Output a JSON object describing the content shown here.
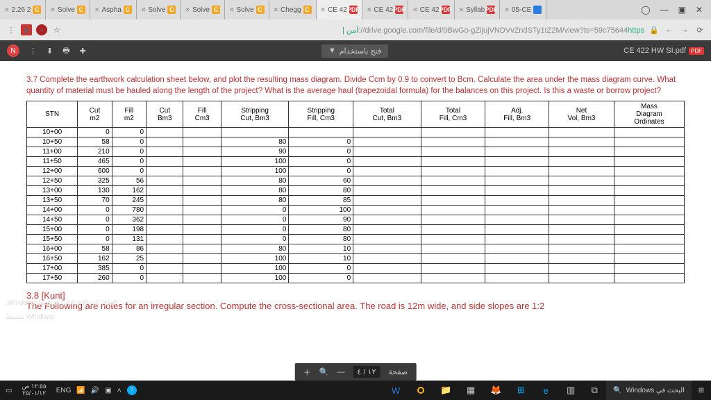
{
  "tabs": [
    {
      "label": "2.26 2",
      "ico": "C",
      "cls": "ico-c"
    },
    {
      "label": "Solve",
      "ico": "C",
      "cls": "ico-c"
    },
    {
      "label": "Aspha",
      "ico": "C",
      "cls": "ico-c"
    },
    {
      "label": "Solve",
      "ico": "C",
      "cls": "ico-c"
    },
    {
      "label": "Solve",
      "ico": "C",
      "cls": "ico-c"
    },
    {
      "label": "Solve",
      "ico": "C",
      "cls": "ico-c"
    },
    {
      "label": "Chegg",
      "ico": "C",
      "cls": "ico-c"
    },
    {
      "label": "CE 42",
      "ico": "PDF",
      "cls": "ico-pdf",
      "active": true
    },
    {
      "label": "CE 42",
      "ico": "PDF",
      "cls": "ico-pdf"
    },
    {
      "label": "CE 42",
      "ico": "PDF",
      "cls": "ico-pdf"
    },
    {
      "label": "Syllab",
      "ico": "PDF",
      "cls": "ico-pdf"
    },
    {
      "label": "05-CE",
      "ico": "",
      "cls": "ico-g"
    }
  ],
  "url": {
    "secure": "https",
    "rest": "://drive.google.com/file/d/0BwGo-gZijujVNDVvZndSTy1tZ2M/view?ts=59c75644",
    "suffix": " | آمن"
  },
  "pdf": {
    "avatar": "N",
    "title": "CE 422 HW SI.pdf",
    "badge": "PDF",
    "openwith": "فتح باستخدام",
    "page_cur": "٤",
    "page_sep": "/",
    "page_total": "١٢",
    "page_label": "صفحة"
  },
  "problem": {
    "text": "3.7 Complete the earthwork calculation sheet below, and plot the resulting mass diagram. Divide Ccm by 0.9 to convert to Bcm. Calculate the area under the mass diagram curve. What quantity of material must be hauled along the length of the project? What is the average haul (trapezoidal formula) for the balances on this project. Is this a waste or borrow project?"
  },
  "headers": [
    "STN",
    "Cut\nm2",
    "Fill\nm2",
    "Cut\nBm3",
    "Fill\nCm3",
    "Stripping\nCut, Bm3",
    "Stripping\nFill, Cm3",
    "Total\nCut, Bm3",
    "Total\nFill, Cm3",
    "Adj.\nFill, Bm3",
    "Net\nVol, Bm3",
    "Mass\nDiagram\nOrdinates"
  ],
  "rows": [
    [
      "10+00",
      "0",
      "0",
      "",
      "",
      "",
      "",
      "",
      "",
      "",
      "",
      ""
    ],
    [
      "10+50",
      "58",
      "0",
      "",
      "",
      "80",
      "0",
      "",
      "",
      "",
      "",
      ""
    ],
    [
      "11+00",
      "210",
      "0",
      "",
      "",
      "90",
      "0",
      "",
      "",
      "",
      "",
      ""
    ],
    [
      "11+50",
      "465",
      "0",
      "",
      "",
      "100",
      "0",
      "",
      "",
      "",
      "",
      ""
    ],
    [
      "12+00",
      "600",
      "0",
      "",
      "",
      "100",
      "0",
      "",
      "",
      "",
      "",
      ""
    ],
    [
      "12+50",
      "325",
      "56",
      "",
      "",
      "80",
      "60",
      "",
      "",
      "",
      "",
      ""
    ],
    [
      "13+00",
      "130",
      "162",
      "",
      "",
      "80",
      "80",
      "",
      "",
      "",
      "",
      ""
    ],
    [
      "13+50",
      "70",
      "245",
      "",
      "",
      "80",
      "85",
      "",
      "",
      "",
      "",
      ""
    ],
    [
      "14+00",
      "0",
      "780",
      "",
      "",
      "0",
      "100",
      "",
      "",
      "",
      "",
      ""
    ],
    [
      "14+50",
      "0",
      "362",
      "",
      "",
      "0",
      "90",
      "",
      "",
      "",
      "",
      ""
    ],
    [
      "15+00",
      "0",
      "198",
      "",
      "",
      "0",
      "80",
      "",
      "",
      "",
      "",
      ""
    ],
    [
      "15+50",
      "0",
      "131",
      "",
      "",
      "0",
      "80",
      "",
      "",
      "",
      "",
      ""
    ],
    [
      "16+00",
      "58",
      "86",
      "",
      "",
      "80",
      "10",
      "",
      "",
      "",
      "",
      ""
    ],
    [
      "16+50",
      "162",
      "25",
      "",
      "",
      "100",
      "10",
      "",
      "",
      "",
      "",
      ""
    ],
    [
      "17+00",
      "385",
      "0",
      "",
      "",
      "100",
      "0",
      "",
      "",
      "",
      "",
      ""
    ],
    [
      "17+50",
      "260",
      "0",
      "",
      "",
      "100",
      "0",
      "",
      "",
      "",
      "",
      ""
    ]
  ],
  "after": {
    "head": "3.8 [Kunt]",
    "body": "The Following are notes for an irregular section. Compute the cross-sectional area. The road is 12m wide, and side slopes are 1:2",
    "wm1": "انتقل إلى الإعدادات لتنشيط Windows.",
    "wm2": "Windows تنشيط"
  },
  "taskbar": {
    "search": "البحث في Windows",
    "time": "١٢:٥٥ ص",
    "date": "٢٥/٠١/١٢",
    "lang": "ENG"
  }
}
